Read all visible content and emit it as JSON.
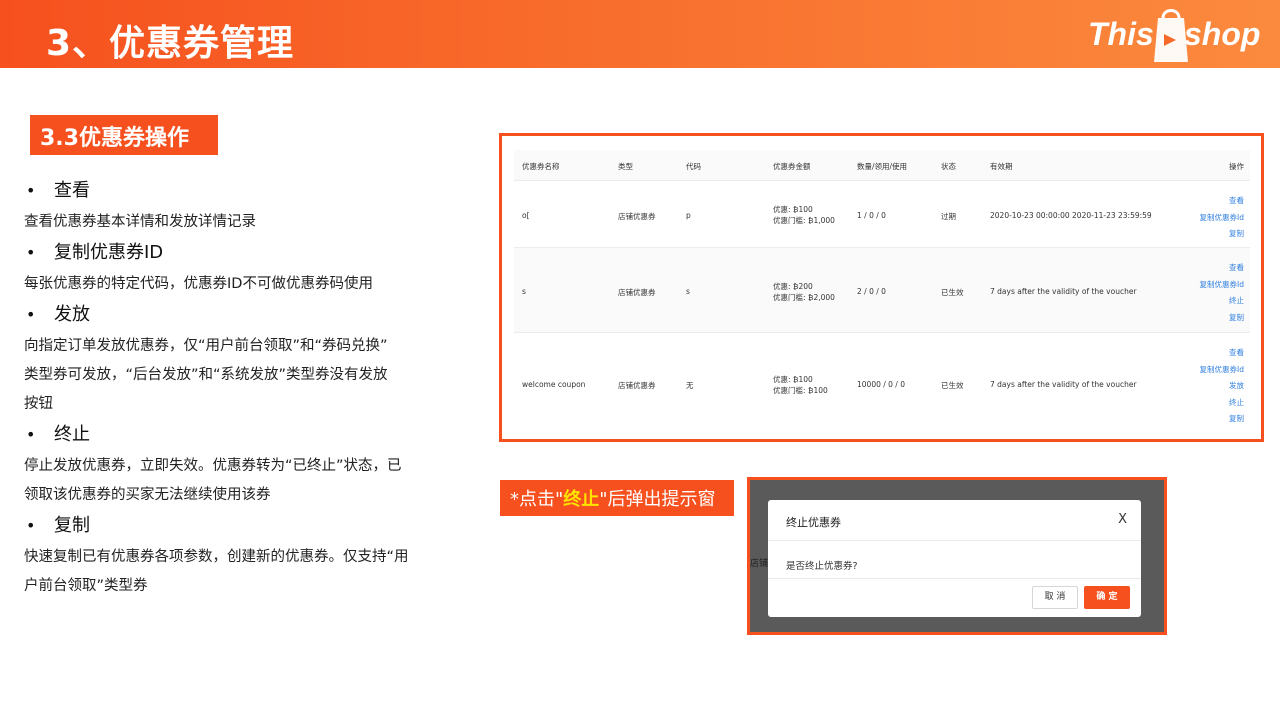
{
  "header": {
    "title": "3、优惠券管理",
    "logo": {
      "left": "This",
      "right": "shop"
    }
  },
  "section_tag": "3.3优惠券操作",
  "operations": [
    {
      "title": "查看",
      "desc": [
        "查看优惠券基本详情和发放详情记录"
      ]
    },
    {
      "title": "复制优惠券ID",
      "desc": [
        "每张优惠券的特定代码，优惠券ID不可做优惠券码使用"
      ]
    },
    {
      "title": "发放",
      "desc": [
        "向指定订单发放优惠券，仅“用户前台领取”和“券码兑换”",
        "类型券可发放，“后台发放”和“系统发放”类型券没有发放",
        "按钮"
      ]
    },
    {
      "title": "终止",
      "desc": [
        "停止发放优惠券，立即失效。优惠券转为“已终止”状态，已",
        "领取该优惠券的买家无法继续使用该券"
      ]
    },
    {
      "title": "复制",
      "desc": [
        "快速复制已有优惠券各项参数，创建新的优惠券。仅支持“用",
        "户前台领取”类型券"
      ]
    }
  ],
  "bullet_symbol": "•",
  "table": {
    "headers": {
      "name": "优惠券名称",
      "type": "类型",
      "code": "代码",
      "amount": "优惠券金额",
      "qty": "数量/领用/使用",
      "status": "状态",
      "validity": "有效期",
      "actions": "操作"
    },
    "rows": [
      {
        "name": "o[",
        "type": "店铺优惠券",
        "code": "p",
        "amount1": "优惠: ₿100",
        "amount2": "优惠门槛: ₿1,000",
        "qty": "1 / 0 / 0",
        "status": "过期",
        "validity": "2020-10-23 00:00:00 2020-11-23 23:59:59",
        "actions": [
          "查看",
          "复制优惠券Id",
          "复制"
        ]
      },
      {
        "name": "s",
        "type": "店铺优惠券",
        "code": "s",
        "amount1": "优惠: ₿200",
        "amount2": "优惠门槛: ₿2,000",
        "qty": "2 / 0 / 0",
        "status": "已生效",
        "validity": "7 days after the validity of the voucher",
        "actions": [
          "查看",
          "复制优惠券Id",
          "终止",
          "复制"
        ]
      },
      {
        "name": "welcome coupon",
        "type": "店铺优惠券",
        "code": "无",
        "amount1": "优惠: ₿100",
        "amount2": "优惠门槛: ₿100",
        "qty": "10000 / 0 / 0",
        "status": "已生效",
        "validity": "7 days after the validity of the voucher",
        "actions": [
          "查看",
          "复制优惠券Id",
          "发放",
          "终止",
          "复制"
        ]
      }
    ]
  },
  "note": {
    "prefix": "*点击\"",
    "highlight": "终止",
    "suffix": "\"后弹出提示窗"
  },
  "modal": {
    "behind_text": "店铺",
    "title": "终止优惠券",
    "close": "X",
    "body": "是否终止优惠券?",
    "cancel": "取 消",
    "confirm": "确 定"
  },
  "colors": {
    "accent": "#f6501e",
    "link": "#2f7fe0",
    "highlight": "#ffe400"
  }
}
